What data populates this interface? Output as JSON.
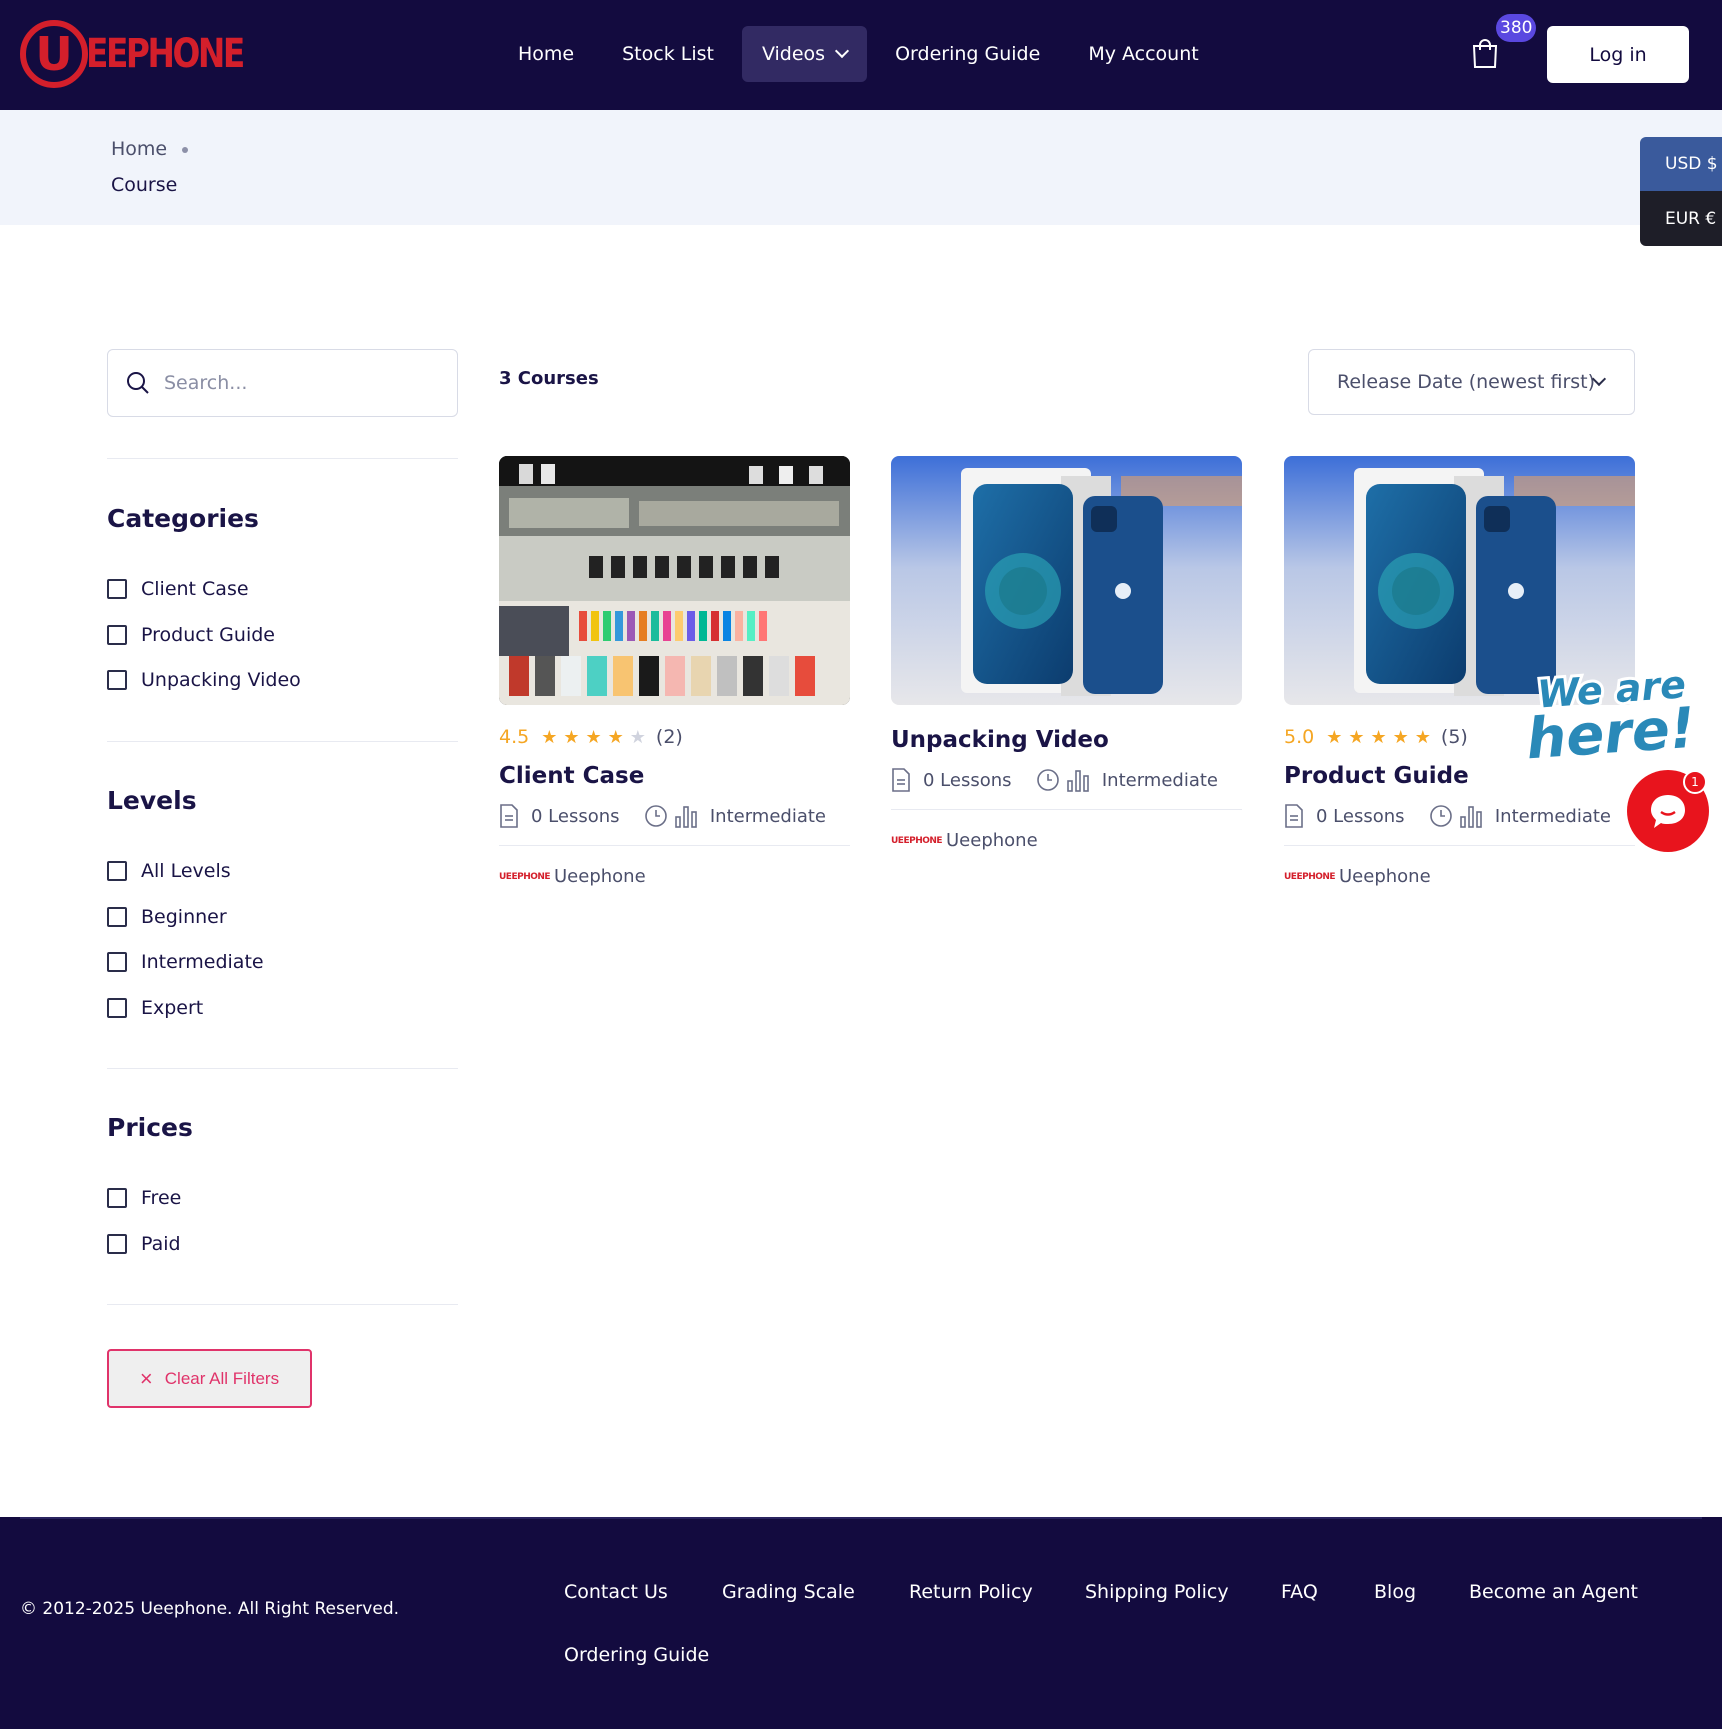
{
  "header": {
    "logo_text": "EEPHONE",
    "logo_letter": "U",
    "nav": [
      {
        "label": "Home"
      },
      {
        "label": "Stock List"
      },
      {
        "label": "Videos"
      },
      {
        "label": "Ordering Guide"
      },
      {
        "label": "My Account"
      }
    ],
    "cart_count": "380",
    "login_label": "Log in"
  },
  "breadcrumb": {
    "home": "Home",
    "current": "Course"
  },
  "currency": {
    "usd": "USD $",
    "eur": "EUR €"
  },
  "sidebar": {
    "search_placeholder": "Search...",
    "categories": {
      "title": "Categories",
      "items": [
        "Client Case",
        "Product Guide",
        "Unpacking Video"
      ]
    },
    "levels": {
      "title": "Levels",
      "items": [
        "All Levels",
        "Beginner",
        "Intermediate",
        "Expert"
      ]
    },
    "prices": {
      "title": "Prices",
      "items": [
        "Free",
        "Paid"
      ]
    },
    "clear_label": "Clear All Filters"
  },
  "main": {
    "course_count": "3 Courses",
    "sort_value": "Release Date (newest first)",
    "courses": [
      {
        "title": "Client Case",
        "rating": "4.5",
        "stars": 4.5,
        "reviews": "(2)",
        "lessons": "0 Lessons",
        "level": "Intermediate",
        "author": "Ueephone",
        "image": "phone-store-display"
      },
      {
        "title": "Unpacking Video",
        "rating": "",
        "stars": 0,
        "reviews": "",
        "lessons": "0 Lessons",
        "level": "Intermediate",
        "author": "Ueephone",
        "image": "blue-iphone-with-box"
      },
      {
        "title": "Product Guide",
        "rating": "5.0",
        "stars": 5,
        "reviews": "(5)",
        "lessons": "0 Lessons",
        "level": "Intermediate",
        "author": "Ueephone",
        "image": "blue-iphone-with-box"
      }
    ]
  },
  "chat": {
    "sticker_text": "We are here!",
    "badge": "1"
  },
  "footer": {
    "copyright": "© 2012-2025 Ueephone. All Right Reserved.",
    "links": [
      "Contact Us",
      "Grading Scale",
      "Return Policy",
      "Shipping Policy",
      "FAQ",
      "Blog",
      "Become an Agent",
      "Ordering Guide"
    ]
  },
  "colors": {
    "navy": "#130b3f",
    "brand_red": "#d41f2b",
    "star": "#f5a623",
    "clear_pink": "#e0336a",
    "usd_blue": "#3a5a9c"
  }
}
